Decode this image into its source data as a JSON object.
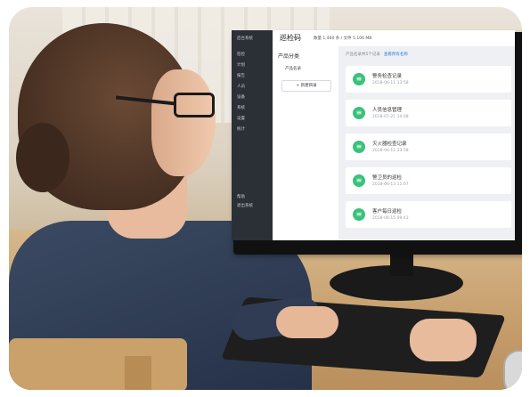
{
  "app": {
    "title": "巡检码",
    "top_info": "数量 1,460 条 / 文件 5,106 MB"
  },
  "sidebar": {
    "items": [
      {
        "label": "后台系统"
      },
      {
        "label": "巡检"
      },
      {
        "label": "计划"
      },
      {
        "label": "报告"
      },
      {
        "label": "人员"
      },
      {
        "label": "设备"
      },
      {
        "label": "系统"
      },
      {
        "label": "设置"
      },
      {
        "label": "统计"
      },
      {
        "label": "帮助"
      },
      {
        "label": "退出系统"
      }
    ]
  },
  "panel": {
    "title": "产品分类",
    "sub": "产品名录",
    "new_button": "+ 新建目录"
  },
  "content": {
    "header": "产品名录共5个记录",
    "header_link": "查看所有名称",
    "cards": [
      {
        "icon": "≡",
        "name": "警务检查记录",
        "date": "2018-06-11 13:58"
      },
      {
        "icon": "≡",
        "name": "人员信息管理",
        "date": "2018-07-21 14:08"
      },
      {
        "icon": "≡",
        "name": "灭火器检查记录",
        "date": "2018-06-11 13:58"
      },
      {
        "icon": "≡",
        "name": "警卫员的巡检",
        "date": "2018-06-13 11:07"
      },
      {
        "icon": "≡",
        "name": "客户每日巡检",
        "date": "2018-06-15 09:43"
      }
    ]
  },
  "colors": {
    "sidebar_bg": "#2b2f36",
    "accent_green": "#3ac27a",
    "link_blue": "#2f7de1",
    "sweater": "#2e3b52",
    "desk": "#c79f6d"
  }
}
